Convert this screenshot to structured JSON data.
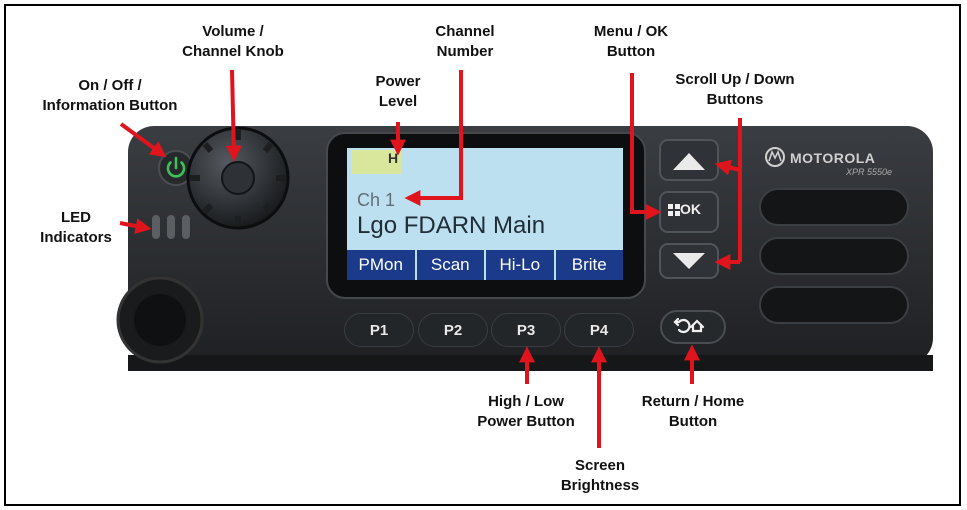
{
  "callouts": {
    "on_off": [
      "On / Off /",
      "Information Button"
    ],
    "volume": [
      "Volume /",
      "Channel Knob"
    ],
    "channel_number": [
      "Channel",
      "Number"
    ],
    "power_level": [
      "Power",
      "Level"
    ],
    "menu_ok": [
      "Menu / OK",
      "Button"
    ],
    "scroll": [
      "Scroll Up / Down",
      "Buttons"
    ],
    "led": [
      "LED",
      "Indicators"
    ],
    "high_low": [
      "High / Low",
      "Power Button"
    ],
    "brightness": [
      "Screen",
      "Brightness"
    ],
    "return_home": [
      "Return / Home",
      "Button"
    ]
  },
  "display": {
    "power_letter": "H",
    "channel": "Ch 1",
    "name": "Lgo FDARN Main",
    "softkeys": [
      "PMon",
      "Scan",
      "Hi-Lo",
      "Brite"
    ]
  },
  "programmable_buttons": [
    "P1",
    "P2",
    "P3",
    "P4"
  ],
  "ok_button_label": "OK",
  "brand": "MOTOROLA",
  "model": "XPR 5550e",
  "colors": {
    "arrow": "#e0141c",
    "display_background": "#bde0f0",
    "softkey_bar": "#1c3a8a",
    "power_led": "#3fbf55",
    "radio_body": "#2a2d30"
  }
}
